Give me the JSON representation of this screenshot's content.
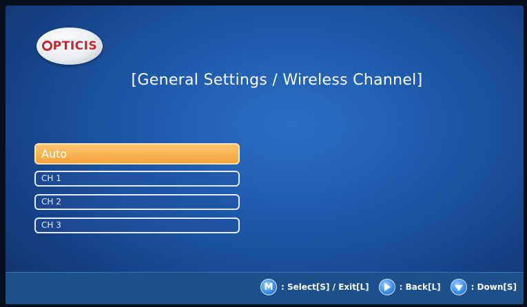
{
  "brand": {
    "logo_text_rest": "PTICIS",
    "logo_name": "opticis-logo"
  },
  "title": "[General Settings / Wireless Channel]",
  "menu": {
    "items": [
      {
        "label": "Auto",
        "selected": true
      },
      {
        "label": "CH 1",
        "selected": false
      },
      {
        "label": "CH 2",
        "selected": false
      },
      {
        "label": "CH 3",
        "selected": false
      }
    ]
  },
  "footer": {
    "hints": [
      {
        "icon": "m-button-icon",
        "key": "M",
        "text": ": Select[S] / Exit[L]"
      },
      {
        "icon": "right-arrow-icon",
        "text": ": Back[L]"
      },
      {
        "icon": "down-arrow-icon",
        "text": ": Down[S]"
      }
    ]
  },
  "colors": {
    "background": "#1d58a8",
    "selected_item": "#f5a43a",
    "logo_red": "#c0282d"
  }
}
